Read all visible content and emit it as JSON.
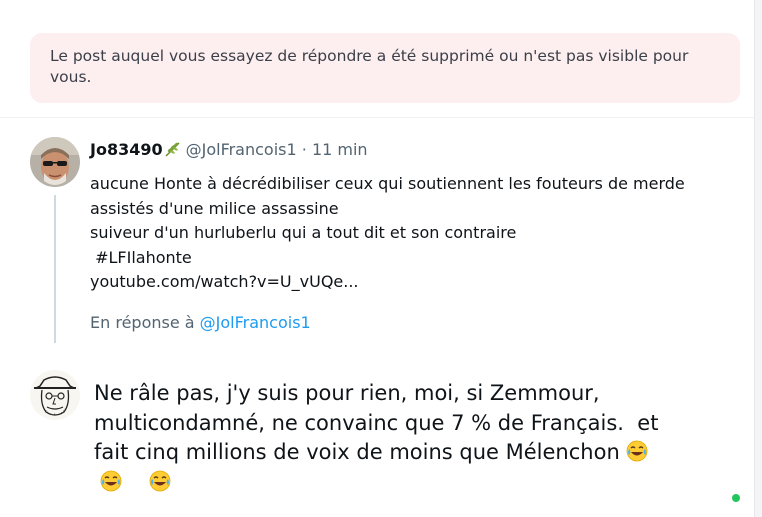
{
  "notice": {
    "text": "Le post auquel vous essayez de répondre a été supprimé ou n'est pas visible pour vous."
  },
  "quoted_post": {
    "author_name": "Jo83490",
    "author_handle": "@JolFrancois1",
    "separator": "·",
    "time": "11 min",
    "lines": [
      "aucune Honte à décrédibiliser ceux qui soutiennent les fouteurs de merde",
      "assistés d'une milice assassine",
      "suiveur d'un hurluberlu qui a tout dit et son contraire",
      " #LFIlahonte",
      "youtube.com/watch?v=U_vUQe..."
    ],
    "reply_prefix": "En réponse à",
    "reply_mention": "@JolFrancois1"
  },
  "composer": {
    "lines": [
      "Ne râle pas, j'y suis pour rien, moi, si Zemmour,",
      "multicondamné, ne convainc que 7 % de Français.  et",
      "fait cinq millions de voix de moins que Mélenchon"
    ],
    "emoji_name": "face-with-tears-of-joy-emoji"
  },
  "icons": {
    "name_badge": "leaf-icon",
    "status": "online-status-icon"
  },
  "colors": {
    "notice_bg": "#fdeef0",
    "link": "#1d9bf0",
    "secondary_text": "#536471",
    "online": "#22c55e"
  }
}
